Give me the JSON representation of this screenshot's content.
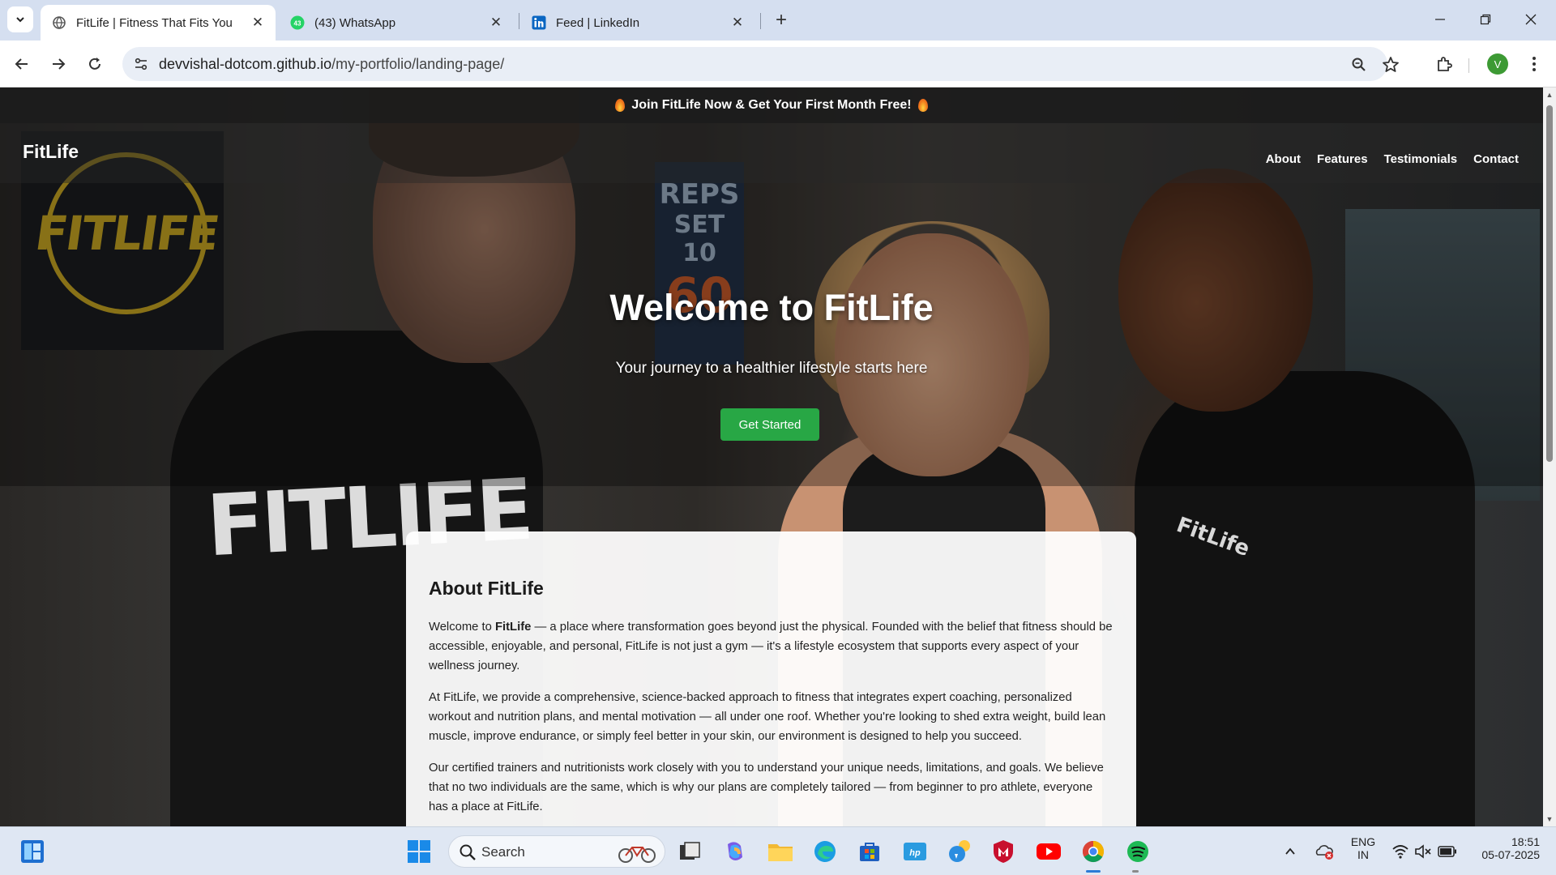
{
  "browser": {
    "tabs": [
      {
        "title": "FitLife | Fitness That Fits You",
        "active": true
      },
      {
        "title": "(43) WhatsApp",
        "badge": "43",
        "active": false
      },
      {
        "title": "Feed | LinkedIn",
        "active": false
      }
    ],
    "url_host": "devvishal-dotcom.github.io",
    "url_path": "/my-portfolio/landing-page/",
    "profile_initial": "V"
  },
  "page": {
    "promo": "Join FitLife Now & Get Your First Month Free!",
    "logo": "FitLife",
    "nav": [
      "About",
      "Features",
      "Testimonials",
      "Contact"
    ],
    "hero": {
      "title": "Welcome to FitLife",
      "subtitle": "Your journey to a healthier lifestyle starts here",
      "cta": "Get Started"
    },
    "image_text": {
      "poster_logo": "FITLIFE",
      "shirt_print": "FITLIFE",
      "reps_poster": [
        "REPS",
        "SET 10",
        "60"
      ],
      "shirt_mark": "FitLife"
    },
    "about": {
      "heading": "About FitLife",
      "p1_intro": "Welcome to ",
      "p1_brand": "FitLife",
      "p1_rest": " — a place where transformation goes beyond just the physical. Founded with the belief that fitness should be accessible, enjoyable, and personal, FitLife is not just a gym — it's a lifestyle ecosystem that supports every aspect of your wellness journey.",
      "p2": "At FitLife, we provide a comprehensive, science-backed approach to fitness that integrates expert coaching, personalized workout and nutrition plans, and mental motivation — all under one roof. Whether you're looking to shed extra weight, build lean muscle, improve endurance, or simply feel better in your skin, our environment is designed to help you succeed.",
      "p3": "Our certified trainers and nutritionists work closely with you to understand your unique needs, limitations, and goals. We believe that no two individuals are the same, which is why our plans are completely tailored — from beginner to pro athlete, everyone has a place at FitLife."
    }
  },
  "taskbar": {
    "search_label": "Search",
    "lang": "ENG",
    "region": "IN",
    "time": "18:51",
    "date": "05-07-2025"
  },
  "colors": {
    "accent_green": "#28a745",
    "browser_chrome": "#d5dff0",
    "poster_gold": "#c9a722"
  }
}
